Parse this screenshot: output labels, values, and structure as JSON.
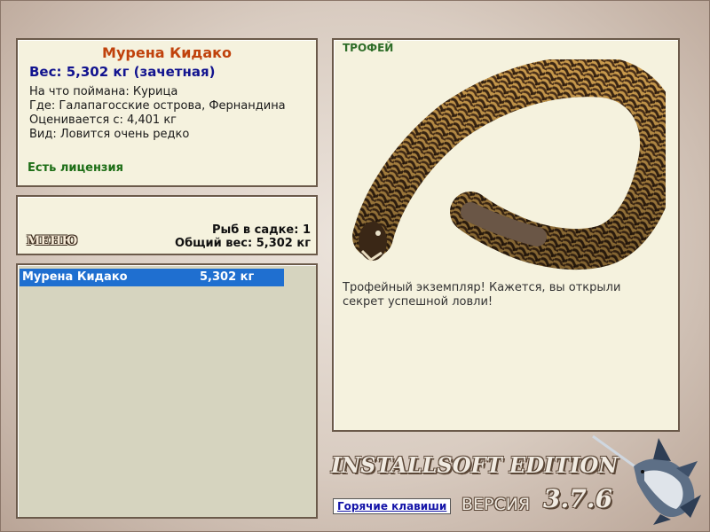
{
  "fish": {
    "name": "Мурена Кидако",
    "weight_line": "Вес: 5,302 кг (зачетная)",
    "caught_on": "На что поймана: Курица",
    "location": "Где: Галапагосские острова, Фернандина",
    "valued_from": "Оценивается с: 4,401 кг",
    "kind": "Вид: Ловится очень редко",
    "license": "Есть лицензия"
  },
  "status": {
    "menu_label": "МЕНЮ",
    "fish_in_keepnet": "Рыб в садке: 1",
    "total_weight": "Общий вес: 5,302 кг"
  },
  "catch_list": [
    {
      "name": "Мурена Кидако",
      "weight": "5,302 кг"
    }
  ],
  "trophy": {
    "label": "ТРОФЕЙ",
    "text": "Трофейный экземпляр! Кажется, вы открыли секрет успешной ловли!"
  },
  "branding": {
    "edition": "INSTALLSOFT EDITION",
    "version_label": "ВЕРСИЯ",
    "version_number": "3.7.6"
  },
  "hotkeys_label": "Горячие клавиши",
  "colors": {
    "panel_bg": "#f5f2de",
    "fish_name": "#c0420c",
    "weight": "#12148f",
    "license": "#1d6e16",
    "selection": "#1f6fd0"
  },
  "icons": [
    "eel-trophy-image",
    "marlin-logo-icon"
  ]
}
